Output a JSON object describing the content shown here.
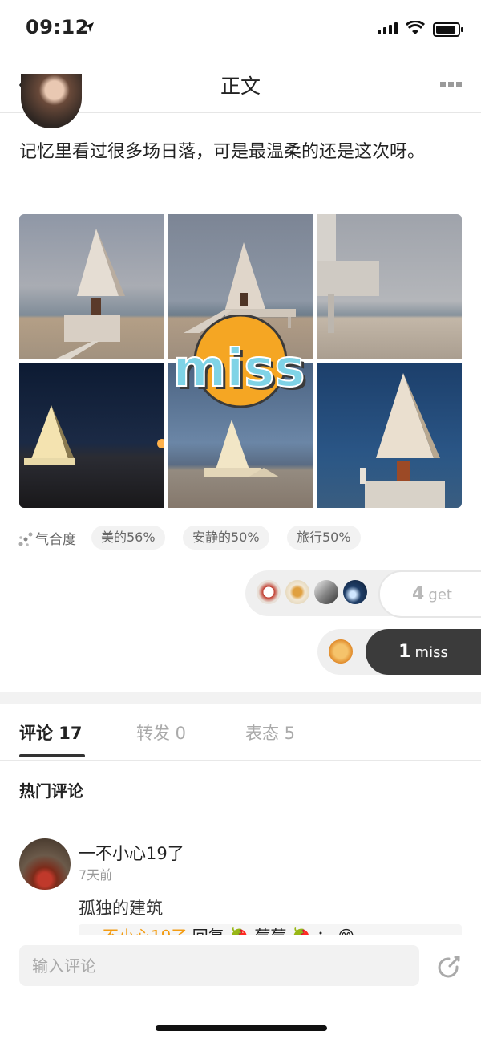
{
  "status_bar": {
    "time": "09:12"
  },
  "nav": {
    "title": "正文"
  },
  "post": {
    "text": "记忆里看过很多场日落，可是最温柔的还是这次呀。",
    "photos": [
      "photo-1",
      "photo-2",
      "photo-3",
      "photo-4",
      "photo-5",
      "photo-6"
    ],
    "sticker_text": "miss",
    "match_label": "气合度",
    "tags": [
      "美的56%",
      "安静的50%",
      "旅行50%"
    ]
  },
  "reactions": {
    "get_count": "4",
    "get_label": "get",
    "miss_count": "1",
    "miss_label": "miss"
  },
  "tabs": [
    {
      "label": "评论 17"
    },
    {
      "label": "转发 0"
    },
    {
      "label": "表态 5"
    }
  ],
  "comments": {
    "section_title": "热门评论",
    "items": [
      {
        "name": "一不小心19了",
        "time": "7天前",
        "text": "孤独的建筑",
        "reply_user": "一不小心19了",
        "reply_text": " 回复 🍓 莓莓 🍓 ： 😊"
      }
    ]
  },
  "bottom": {
    "input_placeholder": "输入评论"
  },
  "colors": {
    "accent_orange": "#F39C12",
    "dark_button": "#3B3B3B",
    "sticker_yellow": "#F5A623",
    "sticker_text": "#7FD3E6"
  }
}
